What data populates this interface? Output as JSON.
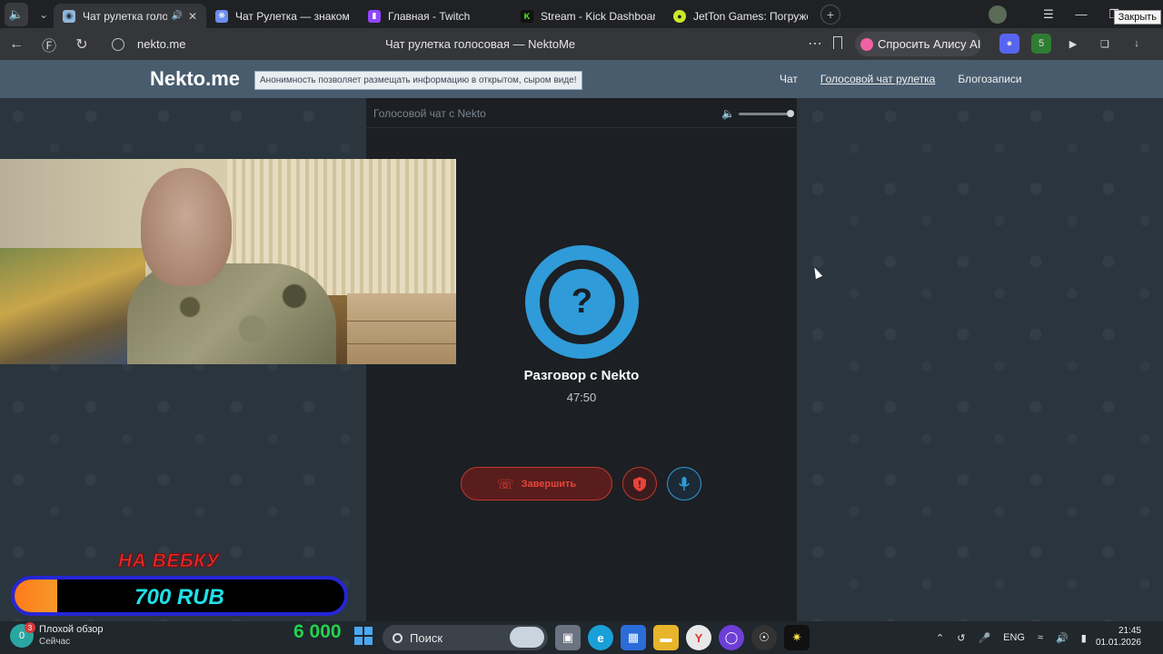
{
  "browser": {
    "tabs": [
      {
        "label": "Чат рулетка голосо",
        "active": true,
        "favicon": "nekto-icon",
        "color": "#8fb7d8"
      },
      {
        "label": "Чат Рулетка — знакомств",
        "active": false,
        "favicon": "chat-icon",
        "color": "#6d8cf0"
      },
      {
        "label": "Главная - Twitch",
        "active": false,
        "favicon": "twitch-icon",
        "color": "#9146ff"
      },
      {
        "label": "Stream - Kick Dashboard",
        "active": false,
        "favicon": "kick-icon",
        "color": "#53fc18"
      },
      {
        "label": "JetTon Games: Погружени",
        "active": false,
        "favicon": "jetton-icon",
        "color": "#c8e82a"
      }
    ],
    "close_tooltip": "Закрыть",
    "url": "nekto.me",
    "page_title": "Чат рулетка голосовая — NektoMe",
    "alice_label": "Спросить Алису AI",
    "extension_badge": "5"
  },
  "site": {
    "logo": "Nekto.me",
    "slogan": "Анонимность позволяет размещать информацию в открытом, сыром виде!",
    "nav": [
      "Чат",
      "Голосовой чат рулетка",
      "Блогозаписи"
    ]
  },
  "chat": {
    "header": "Голосовой чат с Nekto",
    "avatar_glyph": "?",
    "title": "Разговор с Nekto",
    "timer": "47:50",
    "end_label": "Завершить",
    "accent_blue": "#2f9bd8",
    "accent_red": "#e8443a"
  },
  "overlay": {
    "donation_title": "НА ВЕБКУ",
    "donation_amount": "700 RUB",
    "donation_progress_fraction": 0.13,
    "money_counter": "6 000"
  },
  "taskbar": {
    "weather_temp": "0",
    "weather_badge": "3",
    "weather_title": "Плохой обзор",
    "weather_sub": "Сейчас",
    "search_placeholder": "Поиск",
    "lang": "ENG",
    "time": "21:45",
    "date": "01.01.2026"
  }
}
